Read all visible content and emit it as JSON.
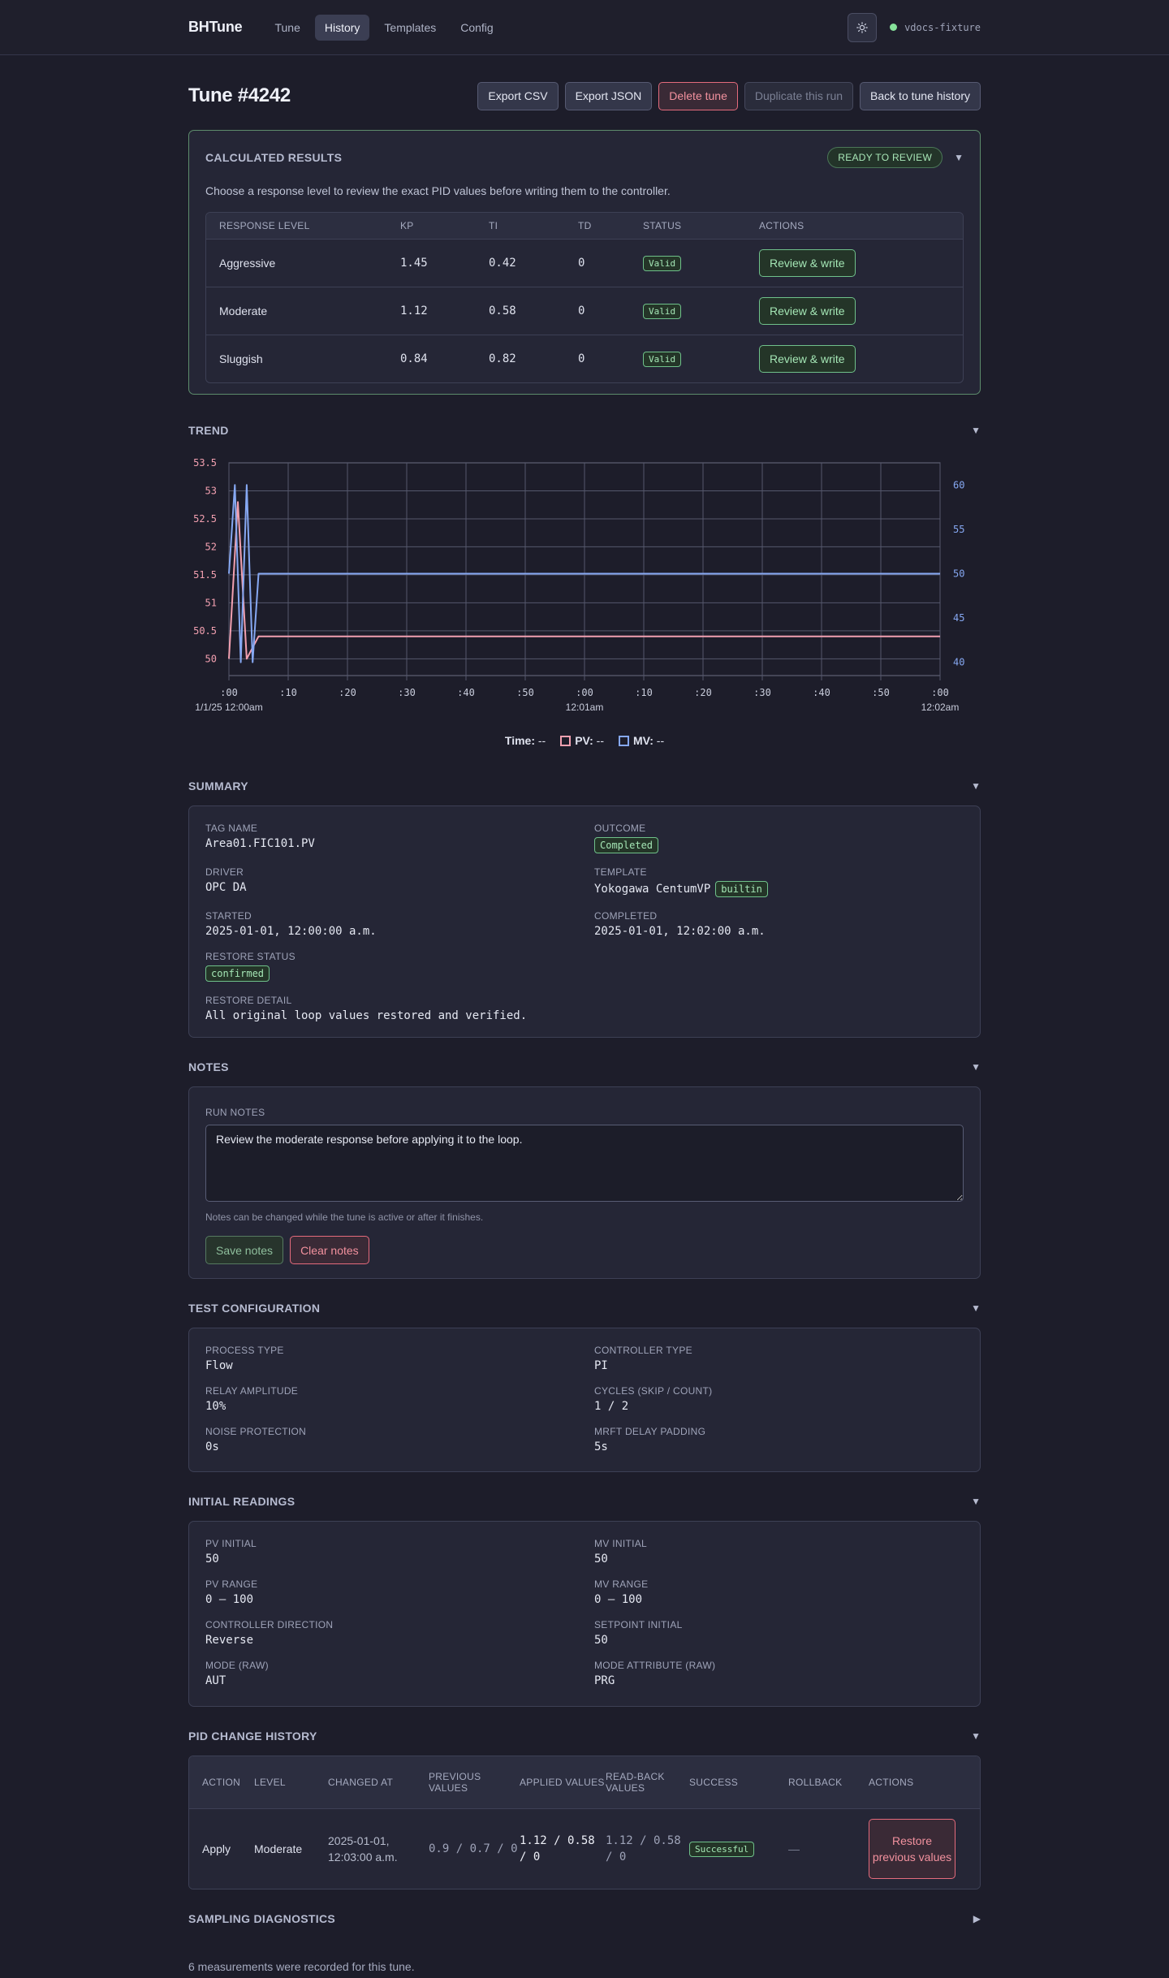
{
  "app": {
    "brand": "BHTune",
    "nav": [
      "Tune",
      "History",
      "Templates",
      "Config"
    ],
    "active_nav": "History",
    "connection": "vdocs-fixture"
  },
  "page": {
    "title": "Tune #4242",
    "actions": {
      "export_csv": "Export CSV",
      "export_json": "Export JSON",
      "delete": "Delete tune",
      "duplicate": "Duplicate this run",
      "back": "Back to tune history"
    }
  },
  "results": {
    "title": "CALCULATED RESULTS",
    "badge": "READY TO REVIEW",
    "description": "Choose a response level to review the exact PID values before writing them to the controller.",
    "columns": [
      "RESPONSE LEVEL",
      "KP",
      "TI",
      "TD",
      "STATUS",
      "ACTIONS"
    ],
    "rows": [
      {
        "level": "Aggressive",
        "kp": "1.45",
        "ti": "0.42",
        "td": "0",
        "status": "Valid",
        "action": "Review & write"
      },
      {
        "level": "Moderate",
        "kp": "1.12",
        "ti": "0.58",
        "td": "0",
        "status": "Valid",
        "action": "Review & write"
      },
      {
        "level": "Sluggish",
        "kp": "0.84",
        "ti": "0.82",
        "td": "0",
        "status": "Valid",
        "action": "Review & write"
      }
    ]
  },
  "trend": {
    "title": "TREND",
    "legend": {
      "time_label": "Time:",
      "time_value": "--",
      "pv_label": "PV:",
      "pv_value": "--",
      "mv_label": "MV:",
      "mv_value": "--"
    },
    "colors": {
      "pv": "#f2a0b0",
      "mv": "#86a8f2",
      "left_axis": "#f2a0b0",
      "right_axis": "#86a8f2"
    }
  },
  "chart_data": {
    "type": "line",
    "x_unit": "seconds from 12:00am",
    "x_tick_labels": [
      ":00",
      ":10",
      ":20",
      ":30",
      ":40",
      ":50",
      ":00",
      ":10",
      ":20",
      ":30",
      ":40",
      ":50",
      ":00"
    ],
    "x_sub_labels": [
      {
        "index": 0,
        "text": "1/1/25 12:00am"
      },
      {
        "index": 6,
        "text": "12:01am"
      },
      {
        "index": 12,
        "text": "12:02am"
      }
    ],
    "xlim": [
      0,
      120
    ],
    "y_left": {
      "ylim": [
        49.7,
        53.5
      ],
      "ticks": [
        "50",
        "50.5",
        "51",
        "51.5",
        "52",
        "52.5",
        "53",
        "53.5"
      ]
    },
    "y_right": {
      "ylim": [
        38.5,
        62.5
      ],
      "ticks": [
        "40",
        "45",
        "50",
        "55",
        "60"
      ]
    },
    "series": [
      {
        "name": "PV",
        "axis": "left",
        "x": [
          0,
          1.5,
          3,
          5,
          120
        ],
        "y": [
          50,
          52.8,
          50,
          50.4,
          50.4
        ]
      },
      {
        "name": "MV",
        "axis": "right",
        "x": [
          0,
          1,
          2,
          3,
          4,
          5,
          120
        ],
        "y": [
          50,
          60,
          40,
          60,
          40,
          50,
          50
        ]
      }
    ],
    "grid": true
  },
  "summary": {
    "title": "SUMMARY",
    "fields": [
      {
        "label": "TAG NAME",
        "value": "Area01.FIC101.PV"
      },
      {
        "label": "OUTCOME",
        "badge": "Completed"
      },
      {
        "label": "DRIVER",
        "value": "OPC DA"
      },
      {
        "label": "TEMPLATE",
        "value": "Yokogawa CentumVP",
        "badge": "builtin"
      },
      {
        "label": "STARTED",
        "value": "2025-01-01, 12:00:00 a.m."
      },
      {
        "label": "COMPLETED",
        "value": "2025-01-01, 12:02:00 a.m."
      }
    ],
    "restore_status_label": "RESTORE STATUS",
    "restore_status": "confirmed",
    "restore_detail_label": "RESTORE DETAIL",
    "restore_detail": "All original loop values restored and verified."
  },
  "notes": {
    "title": "NOTES",
    "label": "RUN NOTES",
    "value": "Review the moderate response before applying it to the loop.",
    "help": "Notes can be changed while the tune is active or after it finishes.",
    "save": "Save notes",
    "clear": "Clear notes"
  },
  "test_config": {
    "title": "TEST CONFIGURATION",
    "fields": [
      {
        "label": "PROCESS TYPE",
        "value": "Flow"
      },
      {
        "label": "CONTROLLER TYPE",
        "value": "PI"
      },
      {
        "label": "RELAY AMPLITUDE",
        "value": "10%"
      },
      {
        "label": "CYCLES (SKIP / COUNT)",
        "value": "1 / 2"
      },
      {
        "label": "NOISE PROTECTION",
        "value": "0s"
      },
      {
        "label": "MRFT DELAY PADDING",
        "value": "5s"
      }
    ]
  },
  "initial_readings": {
    "title": "INITIAL READINGS",
    "fields": [
      {
        "label": "PV INITIAL",
        "value": "50"
      },
      {
        "label": "MV INITIAL",
        "value": "50"
      },
      {
        "label": "PV RANGE",
        "value": "0 – 100"
      },
      {
        "label": "MV RANGE",
        "value": "0 – 100"
      },
      {
        "label": "CONTROLLER DIRECTION",
        "value": "Reverse"
      },
      {
        "label": "SETPOINT INITIAL",
        "value": "50"
      },
      {
        "label": "MODE (RAW)",
        "value": "AUT"
      },
      {
        "label": "MODE ATTRIBUTE (RAW)",
        "value": "PRG"
      }
    ]
  },
  "pid_history": {
    "title": "PID CHANGE HISTORY",
    "columns": [
      "ACTION",
      "LEVEL",
      "CHANGED AT",
      "PREVIOUS VALUES",
      "APPLIED VALUES",
      "READ-BACK VALUES",
      "SUCCESS",
      "ROLLBACK",
      "ACTIONS"
    ],
    "rows": [
      {
        "action": "Apply",
        "level": "Moderate",
        "changed_at": "2025-01-01, 12:03:00 a.m.",
        "previous": "0.9 / 0.7 / 0",
        "applied": "1.12 / 0.58 / 0",
        "readback": "1.12 / 0.58 / 0",
        "success": "Successful",
        "rollback": "—",
        "action_button": "Restore previous values"
      }
    ]
  },
  "sampling": {
    "title": "SAMPLING DIAGNOSTICS",
    "footer": "6 measurements were recorded for this tune."
  }
}
